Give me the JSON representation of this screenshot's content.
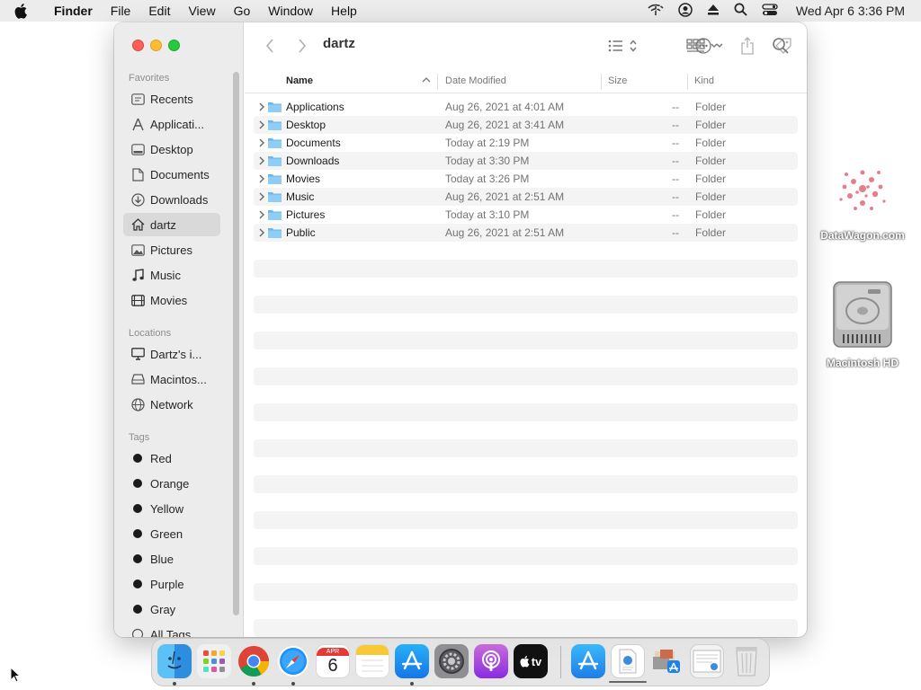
{
  "menubar": {
    "app_name": "Finder",
    "menus": [
      "File",
      "Edit",
      "View",
      "Go",
      "Window",
      "Help"
    ],
    "clock": "Wed Apr 6  3:36 PM",
    "status_icons": [
      "wifi-off-icon",
      "user-icon",
      "eject-icon",
      "spotlight-search-icon",
      "control-center-icon"
    ]
  },
  "desktop": {
    "icons": [
      {
        "label": "DataWagon.com"
      },
      {
        "label": "Macintosh HD"
      }
    ]
  },
  "window": {
    "title": "dartz",
    "sidebar": {
      "favorites_heading": "Favorites",
      "favorites": [
        {
          "label": "Recents",
          "icon": "clock-icon"
        },
        {
          "label": "Applicati...",
          "icon": "applications-icon"
        },
        {
          "label": "Desktop",
          "icon": "desktop-icon"
        },
        {
          "label": "Documents",
          "icon": "document-icon"
        },
        {
          "label": "Downloads",
          "icon": "download-icon"
        },
        {
          "label": "dartz",
          "icon": "home-icon",
          "selected": true
        },
        {
          "label": "Pictures",
          "icon": "photo-icon"
        },
        {
          "label": "Music",
          "icon": "music-note-icon"
        },
        {
          "label": "Movies",
          "icon": "film-icon"
        }
      ],
      "locations_heading": "Locations",
      "locations": [
        {
          "label": "Dartz's i...",
          "icon": "computer-icon"
        },
        {
          "label": "Macintos...",
          "icon": "drive-icon"
        },
        {
          "label": "Network",
          "icon": "globe-icon"
        }
      ],
      "tags_heading": "Tags",
      "tags": [
        {
          "label": "Red"
        },
        {
          "label": "Orange"
        },
        {
          "label": "Yellow"
        },
        {
          "label": "Green"
        },
        {
          "label": "Blue"
        },
        {
          "label": "Purple"
        },
        {
          "label": "Gray"
        },
        {
          "label": "All Tags..."
        }
      ]
    },
    "columns": {
      "name": "Name",
      "date": "Date Modified",
      "size": "Size",
      "kind": "Kind"
    },
    "files": [
      {
        "name": "Applications",
        "date": "Aug 26, 2021 at 4:01 AM",
        "size": "--",
        "kind": "Folder"
      },
      {
        "name": "Desktop",
        "date": "Aug 26, 2021 at 3:41 AM",
        "size": "--",
        "kind": "Folder"
      },
      {
        "name": "Documents",
        "date": "Today at 2:19 PM",
        "size": "--",
        "kind": "Folder"
      },
      {
        "name": "Downloads",
        "date": "Today at 3:30 PM",
        "size": "--",
        "kind": "Folder"
      },
      {
        "name": "Movies",
        "date": "Today at 3:26 PM",
        "size": "--",
        "kind": "Folder"
      },
      {
        "name": "Music",
        "date": "Aug 26, 2021 at 2:51 AM",
        "size": "--",
        "kind": "Folder"
      },
      {
        "name": "Pictures",
        "date": "Today at 3:10 PM",
        "size": "--",
        "kind": "Folder"
      },
      {
        "name": "Public",
        "date": "Aug 26, 2021 at 2:51 AM",
        "size": "--",
        "kind": "Folder"
      }
    ]
  },
  "dock": {
    "calendar_month": "APR",
    "calendar_day": "6",
    "tv_label": "tv",
    "apps": [
      "finder-icon",
      "launchpad-icon",
      "chrome-icon",
      "safari-icon",
      "calendar-icon",
      "notes-icon",
      "app-store-icon",
      "system-preferences-icon",
      "podcasts-icon",
      "apple-tv-icon",
      "app-store-folder-icon",
      "document-icon",
      "applications-stack-icon",
      "preview-icon",
      "trash-icon"
    ]
  }
}
